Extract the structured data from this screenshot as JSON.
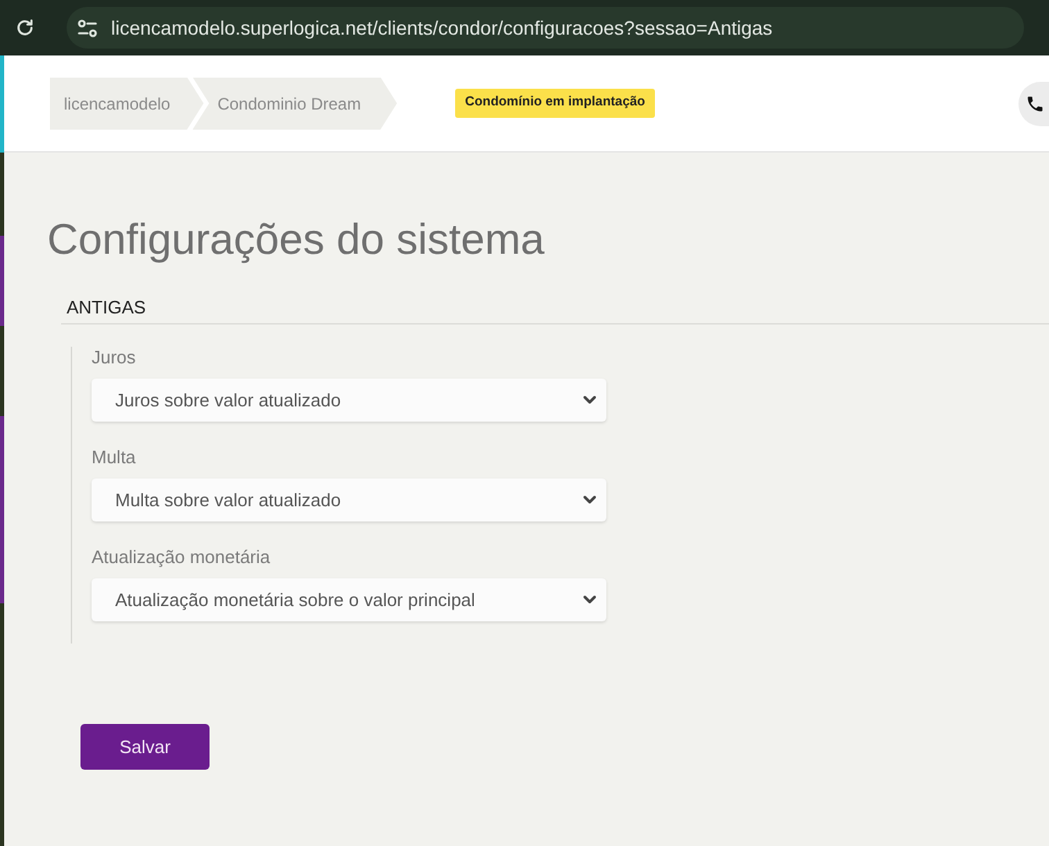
{
  "browser": {
    "url": "licencamodelo.superlogica.net/clients/condor/configuracoes?sessao=Antigas"
  },
  "header": {
    "breadcrumbs": [
      {
        "label": "licencamodelo"
      },
      {
        "label": "Condominio Dream"
      }
    ],
    "status_badge": "Condomínio em implantação"
  },
  "page_title": "Configurações do sistema",
  "section": {
    "title": "ANTIGAS",
    "fields": [
      {
        "label": "Juros",
        "value": "Juros sobre valor atualizado"
      },
      {
        "label": "Multa",
        "value": "Multa sobre valor atualizado"
      },
      {
        "label": "Atualização monetária",
        "value": "Atualização monetária sobre o valor principal"
      }
    ]
  },
  "save_button": "Salvar"
}
